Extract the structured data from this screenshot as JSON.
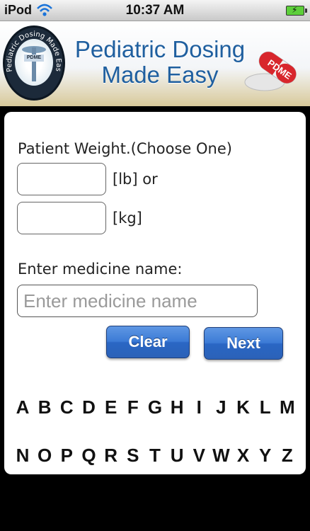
{
  "status_bar": {
    "carrier": "iPod",
    "time": "10:37 AM"
  },
  "banner": {
    "title_line1": "Pediatric Dosing",
    "title_line2": "Made Easy",
    "seal_text": "Pediatric Dosing Made Easy",
    "seal_tag": "PDME",
    "pill_text": "PDME"
  },
  "form": {
    "weight_label": "Patient Weight.(Choose One)",
    "lb_label": "[lb] or",
    "kg_label": "[kg]",
    "medicine_label": "Enter medicine name:",
    "medicine_placeholder": "Enter medicine name",
    "clear_label": "Clear",
    "next_label": "Next"
  },
  "alphabet": {
    "row1": [
      "A",
      "B",
      "C",
      "D",
      "E",
      "F",
      "G",
      "H",
      "I",
      "J",
      "K",
      "L",
      "M"
    ],
    "row2": [
      "N",
      "O",
      "P",
      "Q",
      "R",
      "S",
      "T",
      "U",
      "V",
      "W",
      "X",
      "Y",
      "Z"
    ]
  },
  "colors": {
    "title_blue": "#1f5f9f",
    "button_blue": "#3c7bd6",
    "background": "#000000"
  }
}
